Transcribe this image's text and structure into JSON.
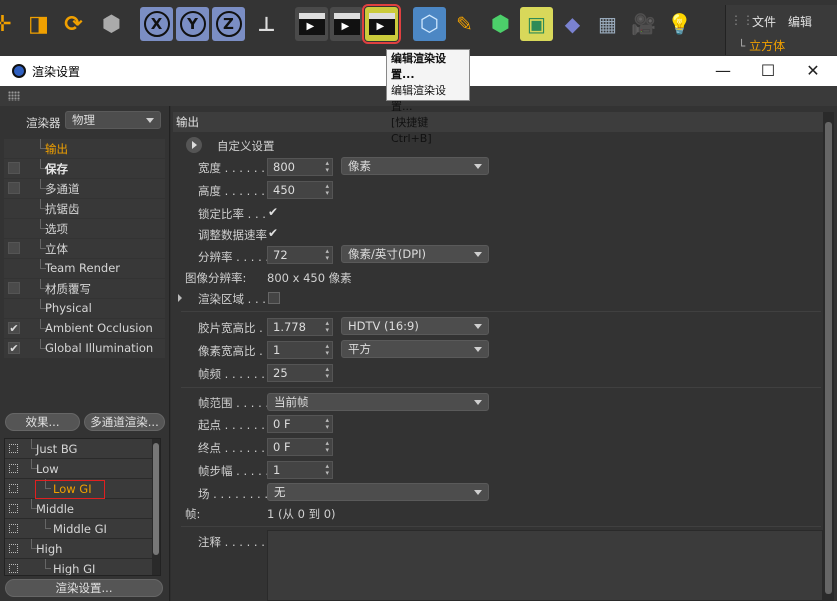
{
  "toolbar": {
    "axis_x": "X",
    "axis_y": "Y",
    "axis_z": "Z",
    "icons": [
      "move-icon",
      "scale-icon",
      "rotate-icon",
      "object-icon",
      "coordinate-system-icon",
      "render-view-icon",
      "render-picture-viewer-icon",
      "edit-render-settings-icon",
      "cube-icon",
      "pen-icon",
      "subdivision-icon",
      "array-icon",
      "deformer-icon",
      "floor-icon",
      "camera-icon",
      "light-icon"
    ]
  },
  "right_menu": {
    "file": "文件",
    "edit": "编辑",
    "object": "立方体"
  },
  "tooltip": {
    "line1": "编辑渲染设置...",
    "line2": "编辑渲染设置...",
    "line3": "[快捷键 Ctrl+B]"
  },
  "window": {
    "title": "渲染设置"
  },
  "left": {
    "renderer_label": "渲染器",
    "renderer_value": "物理",
    "nav": [
      {
        "label": "输出",
        "checked": ""
      },
      {
        "label": "保存",
        "checked": ""
      },
      {
        "label": "多通道",
        "checked": ""
      },
      {
        "label": "抗锯齿",
        "checked": ""
      },
      {
        "label": "选项",
        "checked": ""
      },
      {
        "label": "立体",
        "checked": ""
      },
      {
        "label": "Team Render",
        "checked": ""
      },
      {
        "label": "材质覆写",
        "checked": ""
      },
      {
        "label": "Physical",
        "checked": ""
      },
      {
        "label": "Ambient Occlusion",
        "checked": "✔"
      },
      {
        "label": "Global Illumination",
        "checked": "✔"
      }
    ],
    "effects_button": "效果...",
    "multipass_button": "多通道渲染...",
    "presets": [
      "Just BG",
      "Low",
      "Low GI",
      "Middle",
      "Middle GI",
      "High",
      "High GI"
    ],
    "render_settings_button": "渲染设置..."
  },
  "output": {
    "header": "输出",
    "custom_settings": "自定义设置",
    "width_label": "宽度 . . . . . . .",
    "width": "800",
    "width_unit": "像素",
    "height_label": "高度 . . . . . . .",
    "height": "450",
    "lock_ratio_label": "锁定比率 . . .",
    "lock_ratio": "✔",
    "adjust_rate_label": "调整数据速率",
    "adjust_rate": "✔",
    "resolution_label": "分辨率 . . . . .",
    "resolution": "72",
    "resolution_unit": "像素/英寸(DPI)",
    "image_resolution_label": "图像分辨率:",
    "image_resolution": "800 x 450 像素",
    "render_region_label": "渲染区域 . . .",
    "film_aspect_label": "胶片宽高比 .",
    "film_aspect": "1.778",
    "film_aspect_preset": "HDTV (16:9)",
    "pixel_aspect_label": "像素宽高比 .",
    "pixel_aspect": "1",
    "pixel_aspect_preset": "平方",
    "frame_rate_label": "帧频 . . . . . . .",
    "frame_rate": "25",
    "frame_range_label": "帧范围 . . . . .",
    "frame_range": "当前帧",
    "start_label": "起点 . . . . . . .",
    "start": "0 F",
    "end_label": "终点 . . . . . . .",
    "end": "0 F",
    "frame_step_label": "帧步幅 . . . . .",
    "frame_step": "1",
    "fields_label": "场 . . . . . . . . .",
    "fields": "无",
    "frames_label": "帧:",
    "frames": "1 (从 0 到 0)",
    "notes_label": "注释 . . . . . . ."
  }
}
